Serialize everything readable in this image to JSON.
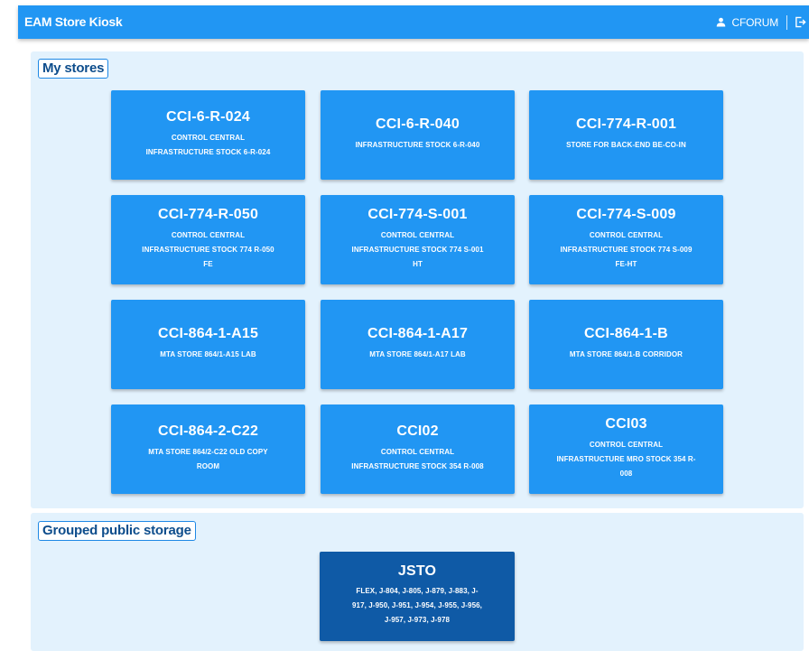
{
  "app": {
    "title": "EAM Store Kiosk",
    "user": "CFORUM"
  },
  "my_stores": {
    "label": "My stores",
    "cards": [
      {
        "title": "CCI-6-R-024",
        "desc": "CONTROL CENTRAL\nINFRASTRUCTURE STOCK 6-R-024"
      },
      {
        "title": "CCI-6-R-040",
        "desc": "INFRASTRUCTURE STOCK 6-R-040"
      },
      {
        "title": "CCI-774-R-001",
        "desc": "STORE FOR BACK-END BE-CO-IN"
      },
      {
        "title": "CCI-774-R-050",
        "desc": "CONTROL CENTRAL\nINFRASTRUCTURE STOCK 774 R-050\nFE"
      },
      {
        "title": "CCI-774-S-001",
        "desc": "CONTROL CENTRAL\nINFRASTRUCTURE STOCK 774 S-001\nHT"
      },
      {
        "title": "CCI-774-S-009",
        "desc": "CONTROL CENTRAL\nINFRASTRUCTURE STOCK 774 S-009\nFE-HT"
      },
      {
        "title": "CCI-864-1-A15",
        "desc": "MTA STORE 864/1-A15 LAB"
      },
      {
        "title": "CCI-864-1-A17",
        "desc": "MTA STORE 864/1-A17 LAB"
      },
      {
        "title": "CCI-864-1-B",
        "desc": "MTA STORE 864/1-B CORRIDOR"
      },
      {
        "title": "CCI-864-2-C22",
        "desc": "MTA STORE 864/2-C22 OLD COPY\nROOM"
      },
      {
        "title": "CCI02",
        "desc": "CONTROL CENTRAL\nINFRASTRUCTURE STOCK 354 R-008"
      },
      {
        "title": "CCI03",
        "desc": "CONTROL CENTRAL\nINFRASTRUCTURE MRO STOCK 354 R-\n008"
      }
    ]
  },
  "grouped_storage": {
    "label": "Grouped public storage",
    "cards": [
      {
        "title": "JSTO",
        "desc": "FLEX, J-804, J-805, J-879, J-883, J-\n917, J-950, J-951, J-954, J-955, J-956,\nJ-957, J-973, J-978"
      }
    ]
  }
}
